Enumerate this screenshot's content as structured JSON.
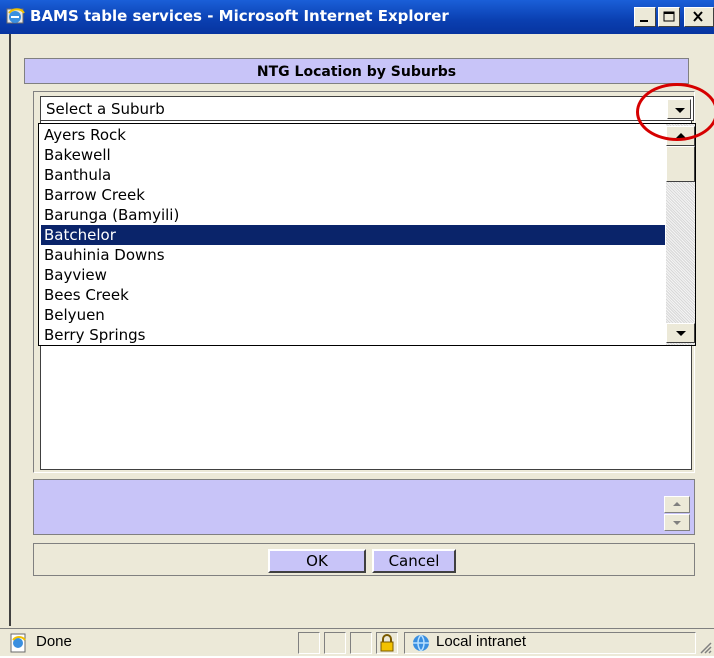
{
  "window": {
    "title": "BAMS table services - Microsoft Internet Explorer"
  },
  "dialog": {
    "header": "NTG Location by Suburbs",
    "select_value": "Select a Suburb",
    "suburbs": [
      "Ayers Rock",
      "Bakewell",
      "Banthula",
      "Barrow Creek",
      "Barunga (Bamyili)",
      "Batchelor",
      "Bauhinia Downs",
      "Bayview",
      "Bees Creek",
      "Belyuen",
      "Berry Springs"
    ],
    "selected_suburb": "Batchelor",
    "ok_label": "OK",
    "cancel_label": "Cancel"
  },
  "statusbar": {
    "status": "Done",
    "zone": "Local intranet"
  },
  "colors": {
    "titlebar": "#0a3fb0",
    "header_bg": "#c8c4f8",
    "selection": "#0a246a",
    "annotation_circle": "#d60000"
  },
  "icons": [
    "ie-icon",
    "minimize-icon",
    "maximize-icon",
    "close-icon",
    "dropdown-arrow-icon",
    "scroll-up-icon",
    "scroll-down-icon",
    "lock-icon",
    "intranet-icon",
    "page-icon"
  ]
}
